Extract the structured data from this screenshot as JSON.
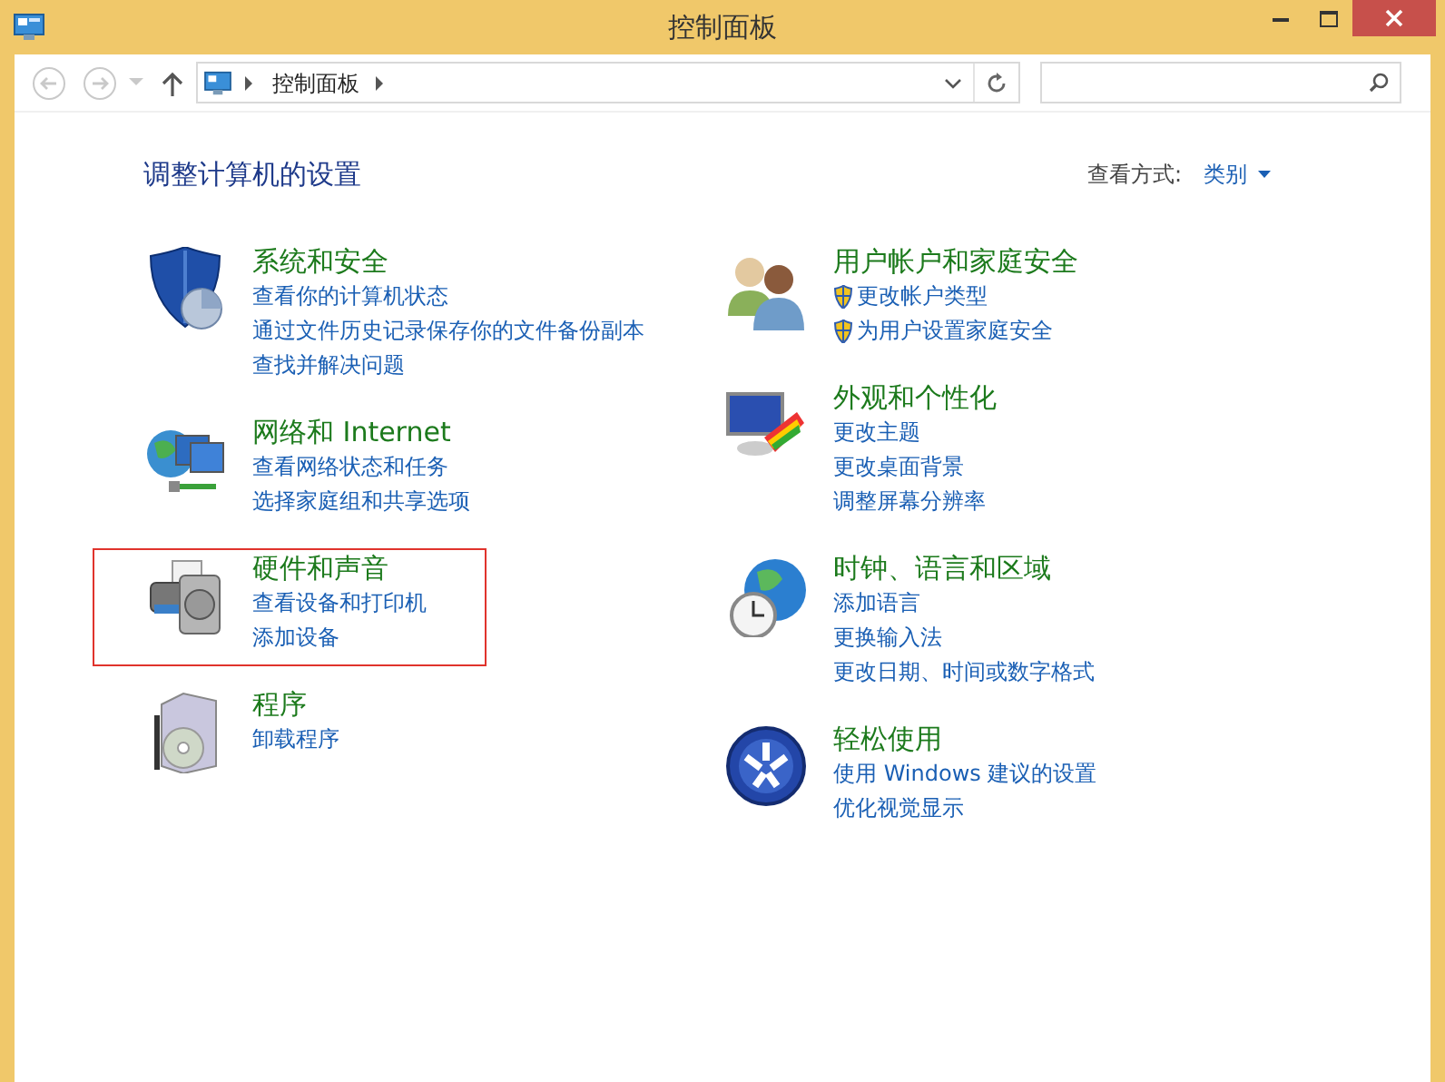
{
  "window": {
    "title": "控制面板"
  },
  "address_bar": {
    "path": [
      "控制面板"
    ]
  },
  "heading": "调整计算机的设置",
  "view_by": {
    "label": "查看方式:",
    "value": "类别"
  },
  "columns": [
    [
      {
        "title": "系统和安全",
        "highlighted": false,
        "links": [
          {
            "text": "查看你的计算机状态",
            "shield": false
          },
          {
            "text": "通过文件历史记录保存你的文件备份副本",
            "shield": false
          },
          {
            "text": "查找并解决问题",
            "shield": false
          }
        ]
      },
      {
        "title": "网络和 Internet",
        "highlighted": false,
        "links": [
          {
            "text": "查看网络状态和任务",
            "shield": false
          },
          {
            "text": "选择家庭组和共享选项",
            "shield": false
          }
        ]
      },
      {
        "title": "硬件和声音",
        "highlighted": true,
        "links": [
          {
            "text": "查看设备和打印机",
            "shield": false
          },
          {
            "text": "添加设备",
            "shield": false
          }
        ]
      },
      {
        "title": "程序",
        "highlighted": false,
        "links": [
          {
            "text": "卸载程序",
            "shield": false
          }
        ]
      }
    ],
    [
      {
        "title": "用户帐户和家庭安全",
        "highlighted": false,
        "links": [
          {
            "text": "更改帐户类型",
            "shield": true
          },
          {
            "text": "为用户设置家庭安全",
            "shield": true
          }
        ]
      },
      {
        "title": "外观和个性化",
        "highlighted": false,
        "links": [
          {
            "text": "更改主题",
            "shield": false
          },
          {
            "text": "更改桌面背景",
            "shield": false
          },
          {
            "text": "调整屏幕分辨率",
            "shield": false
          }
        ]
      },
      {
        "title": "时钟、语言和区域",
        "highlighted": false,
        "links": [
          {
            "text": "添加语言",
            "shield": false
          },
          {
            "text": "更换输入法",
            "shield": false
          },
          {
            "text": "更改日期、时间或数字格式",
            "shield": false
          }
        ]
      },
      {
        "title": "轻松使用",
        "highlighted": false,
        "links": [
          {
            "text": "使用 Windows 建议的设置",
            "shield": false
          },
          {
            "text": "优化视觉显示",
            "shield": false
          }
        ]
      }
    ]
  ]
}
